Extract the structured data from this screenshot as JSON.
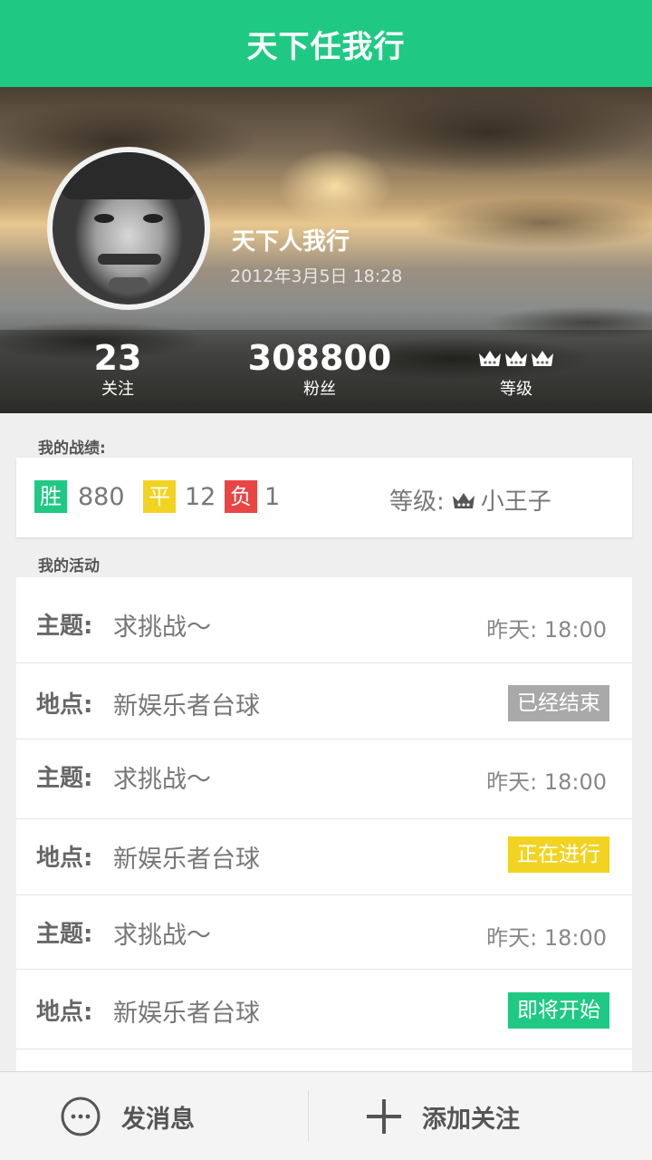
{
  "header": {
    "title": "天下任我行"
  },
  "profile": {
    "name": "天下人我行",
    "datetime": "2012年3月5日 18:28",
    "stats": {
      "following": {
        "value": "23",
        "label": "关注"
      },
      "fans": {
        "value": "308800",
        "label": "粉丝"
      },
      "level": {
        "label": "等级",
        "crowns": 3
      }
    }
  },
  "record": {
    "section_label": "我的战绩:",
    "win": {
      "tag": "胜",
      "count": "880"
    },
    "draw": {
      "tag": "平",
      "count": "12"
    },
    "lose": {
      "tag": "负",
      "count": "1"
    },
    "grade": {
      "label": "等级:",
      "value": "小王子"
    }
  },
  "activities": {
    "section_label": "我的活动",
    "subject_key": "主题:",
    "place_key": "地点:",
    "items": [
      {
        "subject": "求挑战～",
        "time": "昨天: 18:00",
        "place": "新娱乐者台球",
        "status": "已经结束"
      },
      {
        "subject": "求挑战～",
        "time": "昨天: 18:00",
        "place": "新娱乐者台球",
        "status": "正在进行"
      },
      {
        "subject": "求挑战～",
        "time": "昨天: 18:00",
        "place": "新娱乐者台球",
        "status": "即将开始"
      }
    ]
  },
  "bottom_bar": {
    "message_label": "发消息",
    "follow_label": "添加关注"
  },
  "colors": {
    "accent": "#20c983",
    "draw": "#f2d321",
    "lose": "#e84545",
    "ended": "#a9a9a9"
  }
}
